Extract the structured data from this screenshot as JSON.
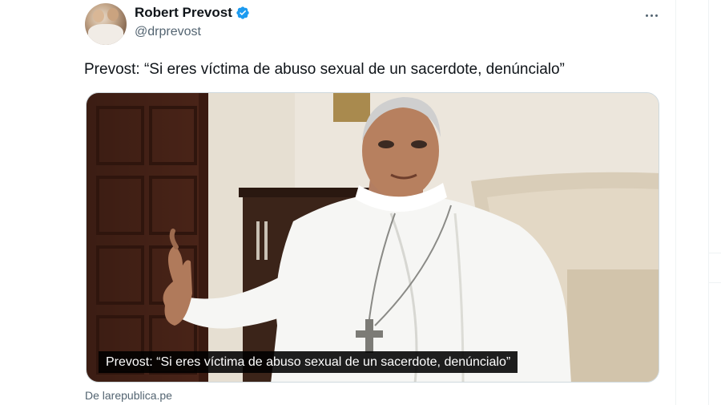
{
  "tweet": {
    "author_name": "Robert Prevost",
    "author_handle": "@drprevost",
    "text": "Prevost: “Si eres víctima de abuso sexual de un sacerdote, denúncialo”",
    "media_caption": "Prevost: “Si eres víctima de abuso sexual de un sacerdote, denúncialo”",
    "source_label": "De larepublica.pe"
  },
  "icons": {
    "verified": "verified-badge-icon",
    "more": "more-options-icon"
  },
  "colors": {
    "verified_blue": "#1d9bf0",
    "secondary_text": "#536471",
    "primary_text": "#0f1419",
    "caption_bg": "#000000"
  }
}
